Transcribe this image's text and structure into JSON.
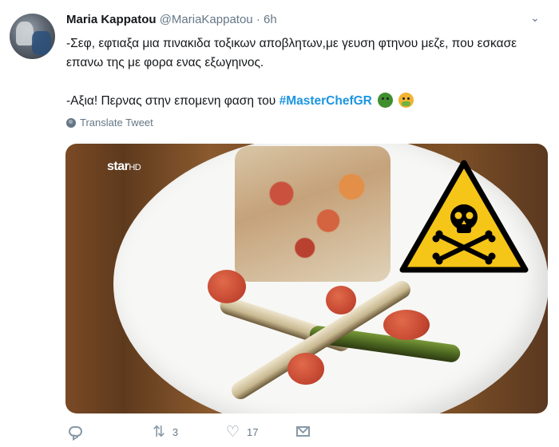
{
  "tweet": {
    "author_name": "Maria Kappatou",
    "author_handle": "@MariaKappatou",
    "separator": "·",
    "time": "6h",
    "line1": "-Σεφ, εφτιαξα μια πινακιδα τοξικων αποβλητων,με γευση φτηνου μεζε, που εσκασε επανω της με φορα ενας εξωγηινος.",
    "line2": "-Αξια! Περνας στην επομενη φαση του",
    "hashtag": "#MasterChefGR",
    "emojis": [
      "nauseated-face",
      "face-vomiting"
    ],
    "translate_label": "Translate Tweet",
    "image": {
      "watermark_main": "star",
      "watermark_sub": "HD",
      "warning_sign": "toxic-skull-crossbones",
      "colors": {
        "warning_yellow": "#f5c518",
        "warning_border": "#000000"
      }
    },
    "actions": {
      "reply_count": "",
      "retweet_count": "3",
      "like_count": "17"
    }
  },
  "colors": {
    "accent": "#1b95e0",
    "secondary_text": "#657786",
    "icon": "#8899a6"
  }
}
